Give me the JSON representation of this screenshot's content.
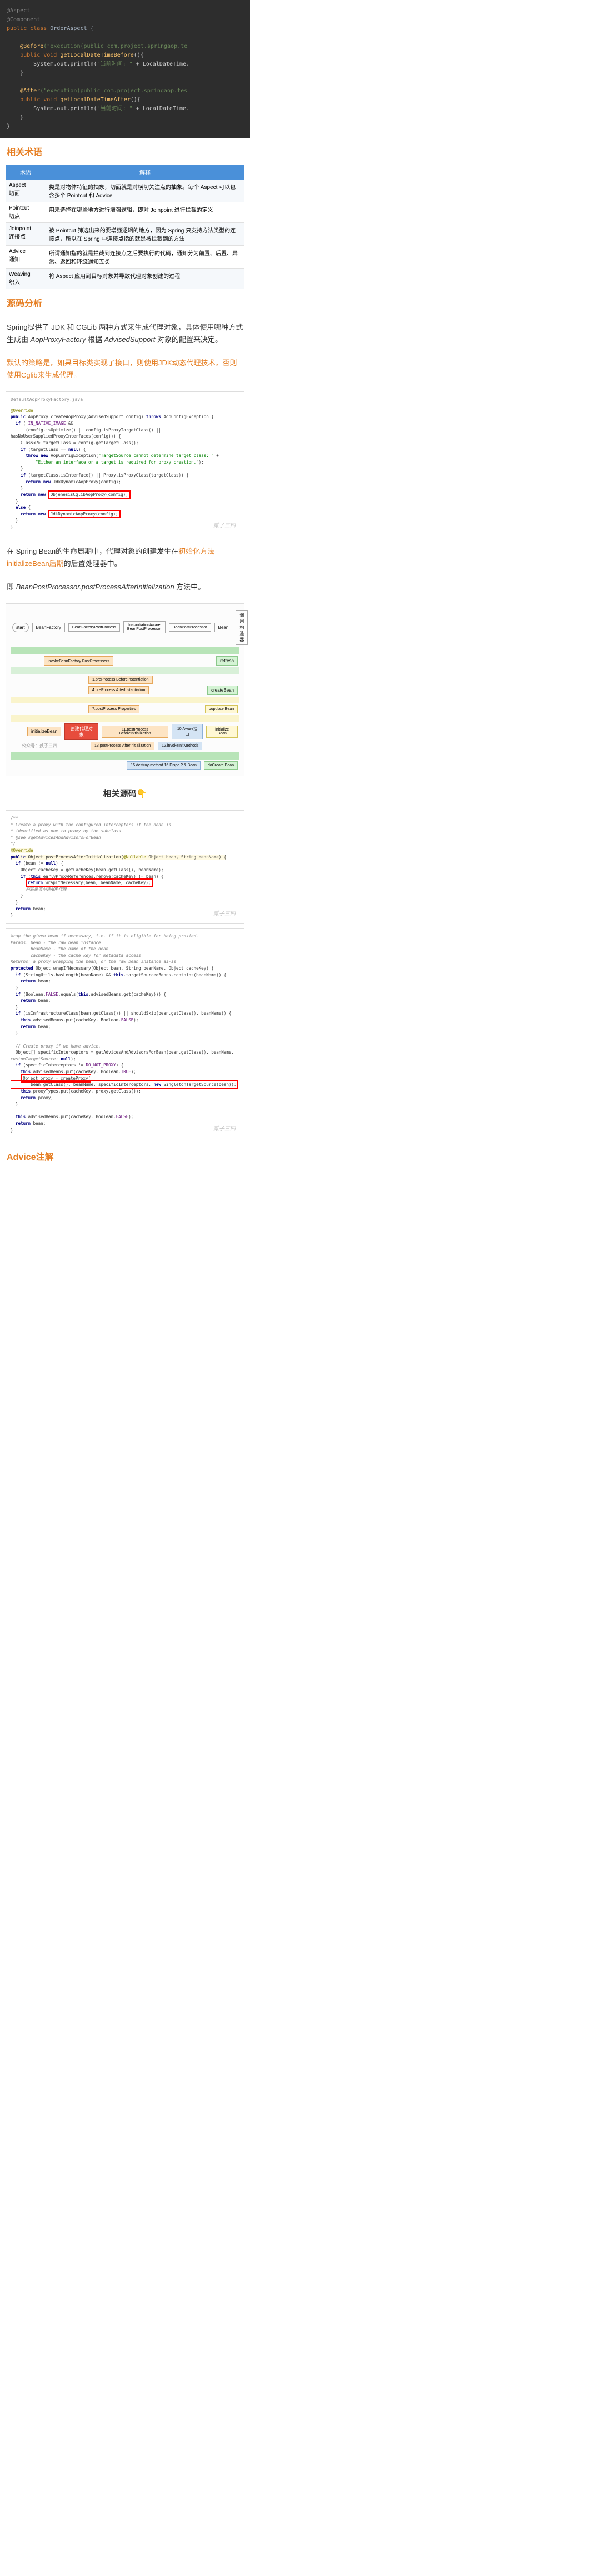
{
  "code1": {
    "l1": "@Aspect",
    "l2": "@Component",
    "l3a": "public class",
    "l3b": " OrderAspect {",
    "l4a": "@Before",
    "l4b": "(\"execution(public com.project.springaop.te",
    "l5a": "public void ",
    "l5b": "getLocalDateTimeBefore",
    "l5c": "(){",
    "l6a": "System.out.println(",
    "l6b": "\"当前时间: \"",
    "l6c": " + LocalDateTime.",
    "l7": "}",
    "l8a": "@After",
    "l8b": "(\"execution(public com.project.springaop.tes",
    "l9a": "public void ",
    "l9b": "getLocalDateTimeAfter",
    "l9c": "(){",
    "l10a": "System.out.println(",
    "l10b": "\"当前时间: \"",
    "l10c": " + LocalDateTime.",
    "l11": "}",
    "l12": "}"
  },
  "sec1": "相关术语",
  "table": {
    "h1": "术语",
    "h2": "解释",
    "r1a": "Aspect",
    "r1b": "切面",
    "r1c": "类是对物体特征的抽象，切面就是对横切关注点的抽象。每个 Aspect 可以包含多个 Pointcut 和 Advice",
    "r2a": "Pointcut",
    "r2b": "切点",
    "r2c": "用来选择在哪些地方进行增强逻辑，即对 Joinpoint 进行拦截的定义",
    "r3a": "Joinpoint",
    "r3b": "连接点",
    "r3c": "被 Pointcut 筛选出来的要增强逻辑的地方，因为 Spring 只支持方法类型的连接点，所以在 Spring 中连接点指的就是被拦截到的方法",
    "r4a": "Advice",
    "r4b": "通知",
    "r4c": "所谓通知指的就是拦截到连接点之后要执行的代码，通知分为前置、后置、异常、返回和环绕通知五类",
    "r5a": "Weaving",
    "r5b": "织入",
    "r5c": "将 Aspect 应用到目标对象并导致代理对象创建的过程"
  },
  "sec2": "源码分析",
  "p1a": "Spring提供了 JDK 和 CGLib 两种方式来生成代理对象，具体使用哪种方式生成由 ",
  "p1b": "AopProxyFactory",
  "p1c": " 根据 ",
  "p1d": "AdvisedSupport",
  "p1e": " 对象的配置来决定。",
  "p2": "默认的策略是，如果目标类实现了接口，则使用JDK动态代理技术，否则使用Cglib来生成代理。",
  "code2": {
    "file": "DefaultAopProxyFactory.java",
    "ov": "@Override",
    "l1": "public AopProxy createAopProxy(AdvisedSupport config) throws AopConfigException {",
    "l2": "if (!IN_NATIVE_IMAGE &&",
    "l3": "(config.isOptimize() || config.isProxyTargetClass() || hasNoUserSuppliedProxyInterfaces(config))) {",
    "l4": "Class<?> targetClass = config.getTargetClass();",
    "l5": "if (targetClass == null) {",
    "l6": "throw new AopConfigException(\"TargetSource cannot determine target class: \" +",
    "l7": "\"Either an interface or a target is required for proxy creation.\");",
    "l8": "}",
    "l9": "if (targetClass.isInterface() || Proxy.isProxyClass(targetClass)) {",
    "l10": "return new JdkDynamicAopProxy(config);",
    "l11": "}",
    "l12": "return new ObjenesisCglibAopProxy(config);",
    "l13": "}",
    "l14": "else {",
    "l15": "return new JdkDynamicAopProxy(config);",
    "l16": "}",
    "l17": "}"
  },
  "p3a": "在 Spring Bean的生命周期中，代理对象的创建发生在",
  "p3b": "初始化方法initializeBean后期",
  "p3c": "的后置处理器中。",
  "p4a": "即 ",
  "p4b": "BeanPostProcessor.postProcessAfterInitialization",
  "p4c": " 方法中。",
  "diagram": {
    "start": "start",
    "bf": "BeanFactory",
    "bfpp": "BeanFactoryPostProcess",
    "ibpp": "InstantiationAware BeanPostProcessor",
    "bpp": "BeanPostProcessor",
    "bean": "Bean",
    "mode": "调用构造器",
    "refresh": "refresh",
    "ibf": "invokeBeanFactory PostProcessors",
    "p1": "1.preProcess BeforeInstantiation",
    "p4": "4.preProcess AfterInstantiation",
    "p7": "7.postProcess Properties",
    "ib": "initializeBean",
    "red": "创建代理对象",
    "p11": "11.postProcess BeforeInitialization",
    "p13": "13.postProcess AfterInitialization",
    "aware": "10.Aware接口",
    "m12": "12.invokeInitMethods",
    "create": "createBean",
    "pop": "populate Bean",
    "init": "initialize Bean",
    "doc": "doCreate Bean",
    "des": "15.destroy-method 16.Dispo ? & Bean",
    "gz": "公众号：贰子三四"
  },
  "sub1": "相关源码👇",
  "code3": {
    "c1": "/**",
    "c2": " * Create a proxy with the configured interceptors if the bean is",
    "c3": " * identified as one to proxy by the subclass.",
    "c4": " * @see #getAdvicesAndAdvisorsForBean",
    "c5": " */",
    "ov": "@Override",
    "l1": "public Object postProcessAfterInitialization(@Nullable Object bean, String beanName) {",
    "l2": "if (bean != null) {",
    "l3": "Object cacheKey = getCacheKey(bean.getClass(), beanName);",
    "l4": "if (this.earlyProxyReferences.remove(cacheKey) != bean) {",
    "l5": "return wrapIfNecessary(bean, beanName, cacheKey);",
    "l5b": "判断是否创建AOP代理",
    "l6": "}",
    "l7": "}",
    "l8": "return bean;",
    "l9": "}"
  },
  "code4": {
    "c1": "Wrap the given bean if necessary, i.e. if it is eligible for being proxied.",
    "c2": "Params: bean - the raw bean instance",
    "c3": "beanName - the name of the bean",
    "c4": "cacheKey - the cache key for metadata access",
    "c5": "Returns: a proxy wrapping the bean, or the raw bean instance as-is",
    "l1": "protected Object wrapIfNecessary(Object bean, String beanName, Object cacheKey) {",
    "l2": "if (StringUtils.hasLength(beanName) && this.targetSourcedBeans.contains(beanName)) {",
    "l3": "return bean;",
    "l4": "}",
    "l5": "if (Boolean.FALSE.equals(this.advisedBeans.get(cacheKey))) {",
    "l6": "return bean;",
    "l7": "}",
    "l8": "if (isInfrastructureClass(bean.getClass()) || shouldSkip(bean.getClass(), beanName)) {",
    "l9": "this.advisedBeans.put(cacheKey, Boolean.FALSE);",
    "l10": "return bean;",
    "l11": "}",
    "l12": "// Create proxy if we have advice.",
    "l13": "Object[] specificInterceptors = getAdvicesAndAdvisorsForBean(bean.getClass(), beanName, customTargetSource: null);",
    "l14": "if (specificInterceptors != DO_NOT_PROXY) {",
    "l15": "this.advisedBeans.put(cacheKey, Boolean.TRUE);",
    "l16a": "Object proxy = createProxy(",
    "l16b": "bean.getClass(), beanName, specificInterceptors, new SingletonTargetSource(bean));",
    "l17": "this.proxyTypes.put(cacheKey, proxy.getClass());",
    "l18": "return proxy;",
    "l19": "}",
    "l20": "this.advisedBeans.put(cacheKey, Boolean.FALSE);",
    "l21": "return bean;",
    "l22": "}"
  },
  "sec3": "Advice注解",
  "wm": "贰子三四"
}
